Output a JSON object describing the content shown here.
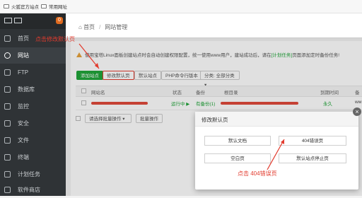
{
  "bookmarks": [
    "火狐官方站点",
    "常用网址"
  ],
  "sidebar": {
    "badge": "0",
    "items": [
      {
        "label": "首页",
        "icon": "home-icon"
      },
      {
        "label": "网站",
        "icon": "globe-icon"
      },
      {
        "label": "FTP",
        "icon": "ftp-icon"
      },
      {
        "label": "数据库",
        "icon": "database-icon"
      },
      {
        "label": "监控",
        "icon": "monitor-icon"
      },
      {
        "label": "安全",
        "icon": "shield-icon"
      },
      {
        "label": "文件",
        "icon": "folder-icon"
      },
      {
        "label": "终端",
        "icon": "terminal-icon"
      },
      {
        "label": "计划任务",
        "icon": "clock-icon"
      },
      {
        "label": "软件商店",
        "icon": "store-icon"
      }
    ]
  },
  "breadcrumb": {
    "home": "首页",
    "sep": "/",
    "current": "网站管理"
  },
  "warning": {
    "text": "使用宝塔Linux面板创建站点时会自动创建权限配置，统一使用www用户，建站成功后，请在",
    "link": "[计划任务]",
    "tail": "页面添加定时备份任务!"
  },
  "toolbar": {
    "add_site": "添加站点",
    "modify_default": "修改默认页",
    "default_site": "默认站点",
    "php_cli": "PHP命令行版本",
    "category": "分类: 全部分类"
  },
  "table": {
    "headers": [
      "网站名",
      "状态",
      "备份",
      "根目录",
      "到期时间",
      "备"
    ],
    "row": {
      "status": "运行中 ▶",
      "backup": "有备份(1)",
      "expire": "永久",
      "note": "ww"
    }
  },
  "bulk": {
    "select": "请选择批量操作",
    "button": "批量操作"
  },
  "modal": {
    "title": "修改默认页",
    "buttons": [
      "默认文档",
      "404错误页",
      "空白页",
      "默认站点停止页"
    ]
  },
  "annotations": {
    "top": "点击修改默认页",
    "bottom": "点击 404错误页"
  },
  "colors": {
    "sidebar": "#2f3336",
    "accent": "#20a53a",
    "annotation": "#e23b2e",
    "badge": "#e06b1f"
  }
}
